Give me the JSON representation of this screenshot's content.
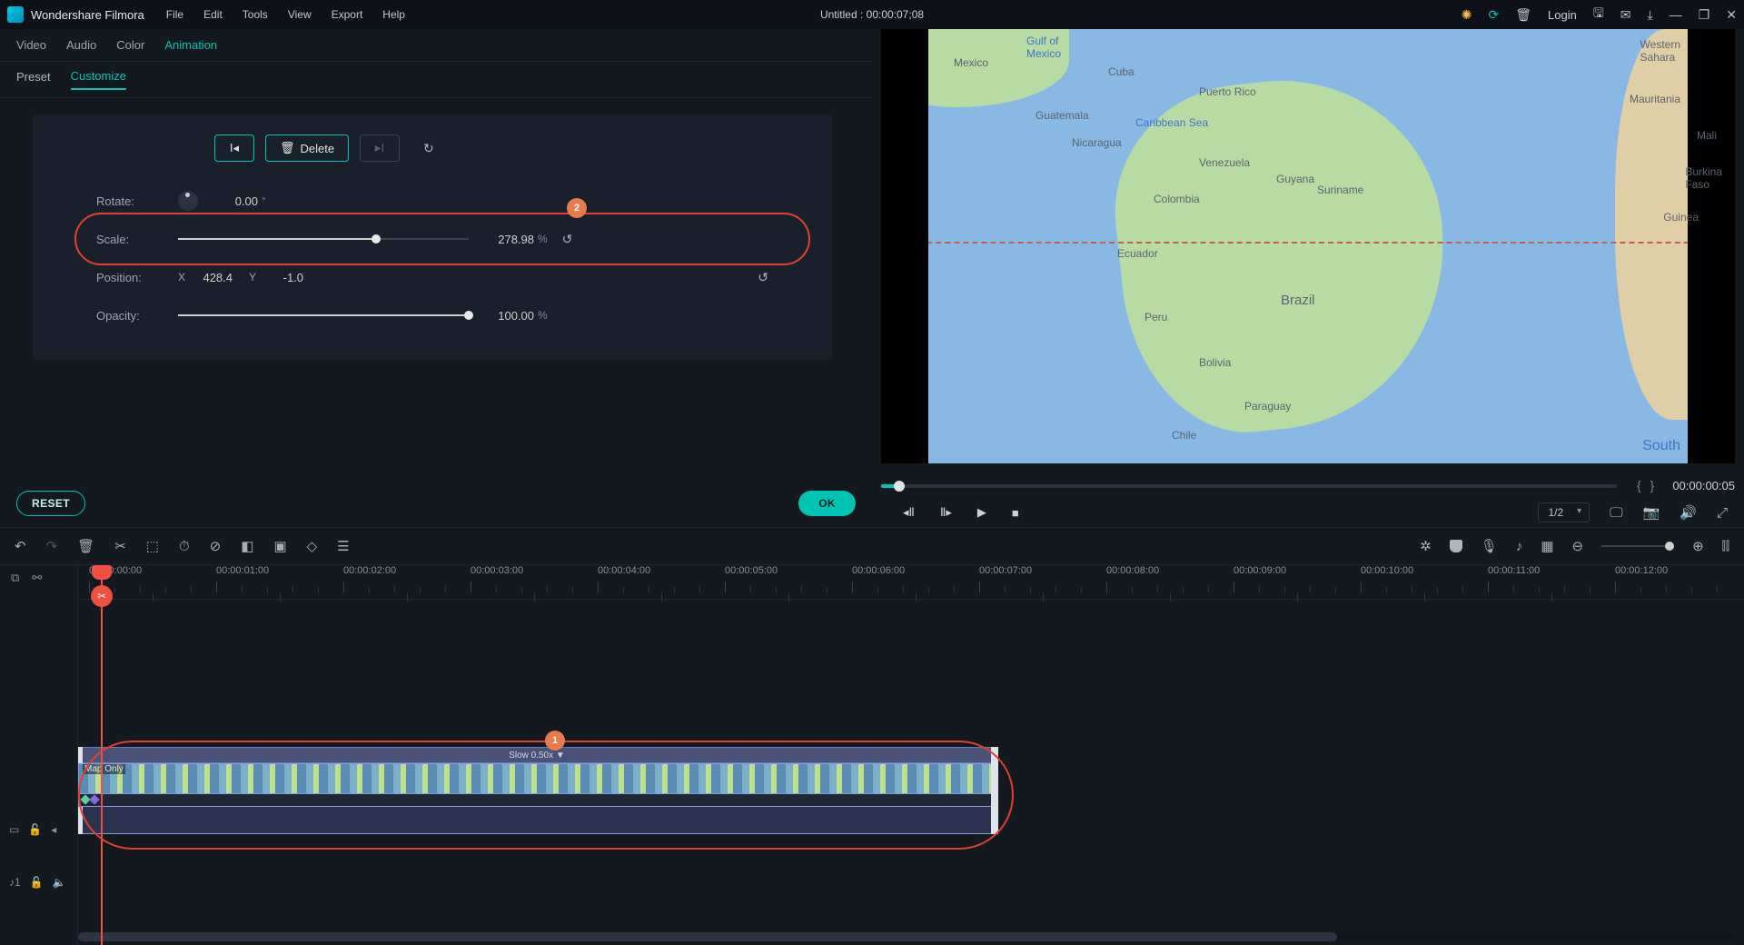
{
  "titlebar": {
    "brand": "Wondershare Filmora",
    "menu": [
      "File",
      "Edit",
      "Tools",
      "View",
      "Export",
      "Help"
    ],
    "doc_title": "Untitled : 00:00:07;08",
    "login": "Login"
  },
  "category_tabs": [
    "Video",
    "Audio",
    "Color",
    "Animation"
  ],
  "category_active": 3,
  "sub_tabs": [
    "Preset",
    "Customize"
  ],
  "sub_active": 1,
  "keyframe_bar": {
    "delete": "Delete"
  },
  "props": {
    "rotate_label": "Rotate:",
    "rotate_value": "0.00",
    "rotate_unit": "°",
    "scale_label": "Scale:",
    "scale_value": "278.98",
    "scale_unit": "%",
    "position_label": "Position:",
    "pos_x_label": "X",
    "pos_x": "428.4",
    "pos_y_label": "Y",
    "pos_y": "-1.0",
    "opacity_label": "Opacity:",
    "opacity_value": "100.00",
    "opacity_unit": "%"
  },
  "buttons": {
    "reset": "RESET",
    "ok": "OK"
  },
  "transport": {
    "timecode": "00:00:00:05",
    "ratio": "1/2"
  },
  "ruler_labels": [
    "00:00:00:00",
    "00:00:01:00",
    "00:00:02:00",
    "00:00:03:00",
    "00:00:04:00",
    "00:00:05:00",
    "00:00:06:00",
    "00:00:07:00",
    "00:00:08:00",
    "00:00:09:00",
    "00:00:10:00",
    "00:00:11:00",
    "00:00:12:00"
  ],
  "clip": {
    "speed_label": "Slow 0.50x ▼",
    "name": "Map Only"
  },
  "preview_labels": {
    "gulf": "Gulf of\nMexico",
    "mexico": "Mexico",
    "cuba": "Cuba",
    "puerto": "Puerto Rico",
    "carib": "Caribbean Sea",
    "guat": "Guatemala",
    "nica": "Nicaragua",
    "venez": "Venezuela",
    "guyana": "Guyana",
    "suri": "Suriname",
    "colom": "Colombia",
    "ecu": "Ecuador",
    "peru": "Peru",
    "brazil": "Brazil",
    "boliv": "Bolivia",
    "para": "Paraguay",
    "chile": "Chile",
    "maur": "Mauritania",
    "wsah": "Western\nSahara",
    "mali": "Mali",
    "guinea": "Guinea",
    "burk": "Burkina\nFaso",
    "south": "South"
  },
  "annotations": {
    "scale_num": "2",
    "clip_num": "1"
  }
}
